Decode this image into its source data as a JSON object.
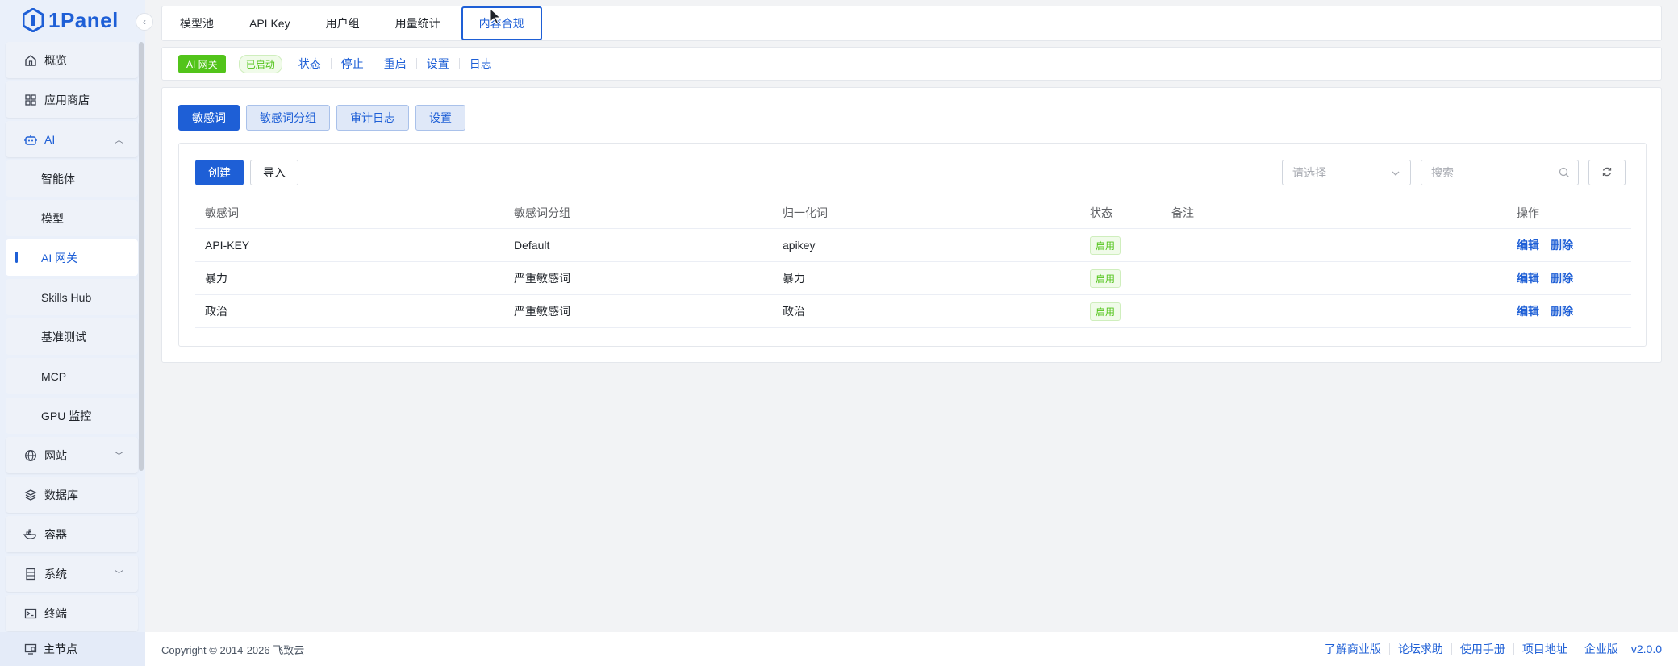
{
  "app": {
    "name": "1Panel",
    "collapse_icon": "chevron-left-icon"
  },
  "sidebar": {
    "items": [
      {
        "label": "概览",
        "icon": "home-icon"
      },
      {
        "label": "应用商店",
        "icon": "grid-icon"
      },
      {
        "label": "AI",
        "icon": "robot-icon",
        "expanded": true
      },
      {
        "label": "智能体"
      },
      {
        "label": "模型"
      },
      {
        "label": "AI 网关",
        "active": true
      },
      {
        "label": "Skills Hub"
      },
      {
        "label": "基准测试"
      },
      {
        "label": "MCP"
      },
      {
        "label": "GPU 监控"
      },
      {
        "label": "网站",
        "icon": "globe-icon"
      },
      {
        "label": "数据库",
        "icon": "layers-icon"
      },
      {
        "label": "容器",
        "icon": "docker-icon"
      },
      {
        "label": "系统",
        "icon": "server-icon"
      },
      {
        "label": "终端",
        "icon": "terminal-icon"
      }
    ],
    "footer": {
      "label": "主节点",
      "icon": "monitor-icon"
    }
  },
  "top_tabs": [
    "模型池",
    "API Key",
    "用户组",
    "用量统计",
    "内容合规"
  ],
  "gateway": {
    "tag": "AI 网关",
    "status": "已启动",
    "links": [
      "状态",
      "停止",
      "重启",
      "设置",
      "日志"
    ]
  },
  "sub_tabs": [
    "敏感词",
    "敏感词分组",
    "审计日志",
    "设置"
  ],
  "toolbar": {
    "create": "创建",
    "import": "导入",
    "select_placeholder": "请选择",
    "search_placeholder": "搜索"
  },
  "table": {
    "headers": [
      "敏感词",
      "敏感词分组",
      "归一化词",
      "状态",
      "备注",
      "操作"
    ],
    "rows": [
      {
        "word": "API-KEY",
        "group": "Default",
        "normalized": "apikey",
        "status": "启用",
        "note": ""
      },
      {
        "word": "暴力",
        "group": "严重敏感词",
        "normalized": "暴力",
        "status": "启用",
        "note": ""
      },
      {
        "word": "政治",
        "group": "严重敏感词",
        "normalized": "政治",
        "status": "启用",
        "note": ""
      }
    ],
    "actions": {
      "edit": "编辑",
      "delete": "删除"
    }
  },
  "footer": {
    "copyright": "Copyright © 2014-2026 飞致云",
    "links": [
      "了解商业版",
      "论坛求助",
      "使用手册",
      "项目地址",
      "企业版"
    ],
    "version": "v2.0.0"
  },
  "colors": {
    "primary": "#1e5fd6",
    "success": "#52c41a",
    "sidebar_bg": "#eaf0fa"
  }
}
